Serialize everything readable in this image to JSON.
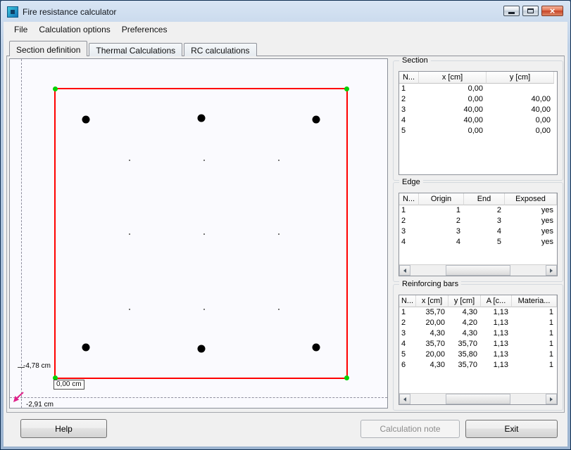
{
  "window": {
    "title": "Fire resistance calculator",
    "close_glyph": "×"
  },
  "menu": {
    "items": [
      "File",
      "Calculation options",
      "Preferences"
    ]
  },
  "tabs": [
    {
      "label": "Section definition"
    },
    {
      "label": "Thermal Calculations"
    },
    {
      "label": "RC calculations"
    }
  ],
  "canvas": {
    "section_size_cm": 40,
    "labels": {
      "axis_left": "-4,78 cm",
      "origin": "0,00 cm",
      "cursor": "-2,91 cm"
    },
    "colors": {
      "outline": "#ff0000",
      "vertex_handle": "#00d200",
      "rebar": "#000000",
      "cursor_arrow": "#e0218a"
    }
  },
  "section_group": {
    "legend": "Section",
    "headers": [
      "N...",
      "x [cm]",
      "y [cm]"
    ],
    "rows": [
      [
        "1",
        "0,00",
        ""
      ],
      [
        "2",
        "0,00",
        "40,00"
      ],
      [
        "3",
        "40,00",
        "40,00"
      ],
      [
        "4",
        "40,00",
        "0,00"
      ],
      [
        "5",
        "0,00",
        "0,00"
      ]
    ]
  },
  "edge_group": {
    "legend": "Edge",
    "headers": [
      "N...",
      "Origin",
      "End",
      "Exposed"
    ],
    "rows": [
      [
        "1",
        "1",
        "2",
        "yes"
      ],
      [
        "2",
        "2",
        "3",
        "yes"
      ],
      [
        "3",
        "3",
        "4",
        "yes"
      ],
      [
        "4",
        "4",
        "5",
        "yes"
      ]
    ]
  },
  "rebar_group": {
    "legend": "Reinforcing bars",
    "headers": [
      "N...",
      "x [cm]",
      "y [cm]",
      "A [c...",
      "Materia..."
    ],
    "rows": [
      [
        "1",
        "35,70",
        "4,30",
        "1,13",
        "1"
      ],
      [
        "2",
        "20,00",
        "4,20",
        "1,13",
        "1"
      ],
      [
        "3",
        "4,30",
        "4,30",
        "1,13",
        "1"
      ],
      [
        "4",
        "35,70",
        "35,70",
        "1,13",
        "1"
      ],
      [
        "5",
        "20,00",
        "35,80",
        "1,13",
        "1"
      ],
      [
        "6",
        "4,30",
        "35,70",
        "1,13",
        "1"
      ]
    ]
  },
  "footer": {
    "help": "Help",
    "calculation_note": "Calculation note",
    "exit": "Exit"
  }
}
